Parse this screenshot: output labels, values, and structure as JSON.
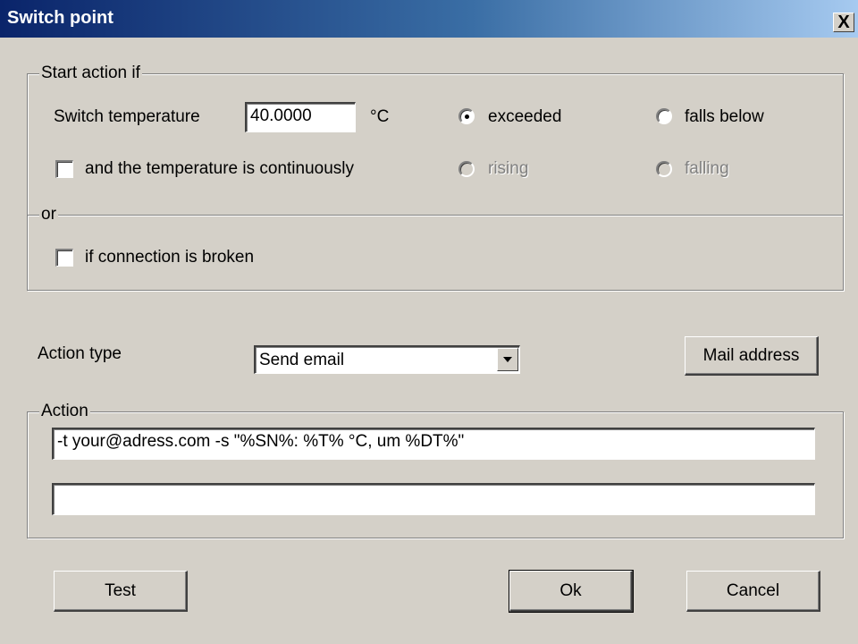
{
  "window": {
    "title": "Switch point",
    "close_label": "X"
  },
  "start_group": {
    "legend": "Start action if",
    "switch_temp_label": "Switch temperature",
    "switch_temp_value": "40.0000",
    "unit": "°C",
    "exceeded_label": "exceeded",
    "falls_below_label": "falls below",
    "continuous_label": "and the temperature is continuously",
    "rising_label": "rising",
    "falling_label": "falling",
    "or_label": "or",
    "broken_label": "if connection is broken",
    "selected_condition": "exceeded"
  },
  "action_type": {
    "label": "Action type",
    "selected": "Send email",
    "mail_button": "Mail address"
  },
  "action_group": {
    "legend": "Action",
    "line1": "-t your@adress.com -s \"%SN%: %T% °C, um %DT%\"",
    "line2": ""
  },
  "buttons": {
    "test": "Test",
    "ok": "Ok",
    "cancel": "Cancel"
  }
}
